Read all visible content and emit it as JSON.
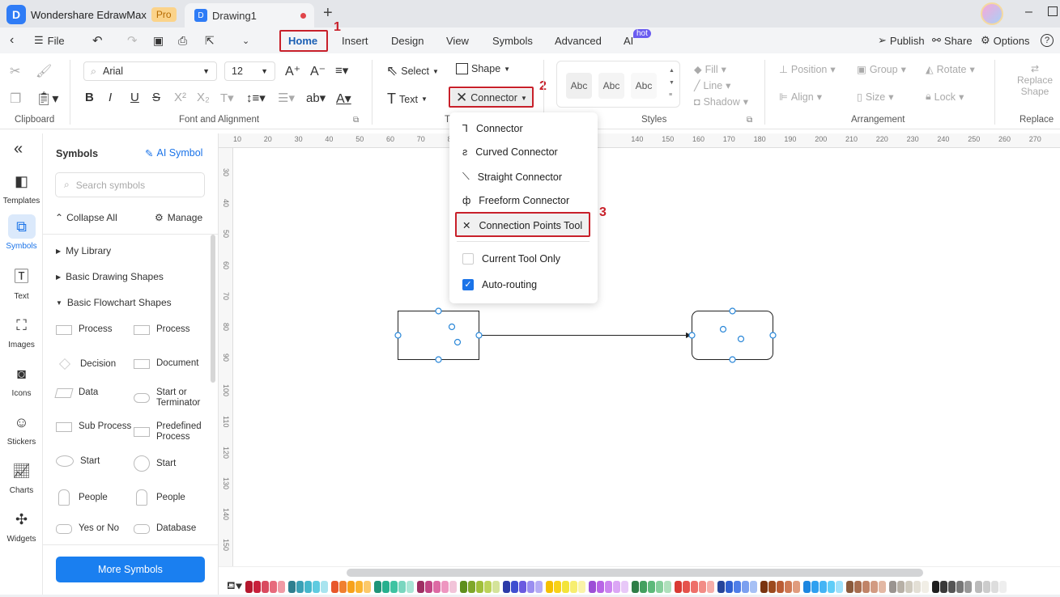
{
  "app": {
    "name": "Wondershare EdrawMax",
    "badge": "Pro",
    "doc_tab": "Drawing1",
    "new_tab": "+"
  },
  "menu": {
    "file": "File",
    "tabs": [
      "Home",
      "Insert",
      "Design",
      "View",
      "Symbols",
      "Advanced",
      "AI"
    ],
    "ai_badge": "hot",
    "publish": "Publish",
    "share": "Share",
    "options": "Options",
    "help": "?"
  },
  "annotations": [
    "1",
    "2",
    "3"
  ],
  "ribbon": {
    "font": "Arial",
    "size": "12",
    "select": "Select",
    "shape": "Shape",
    "text": "Text",
    "connector": "Connector",
    "style_samples": [
      "Abc",
      "Abc",
      "Abc"
    ],
    "fill": "Fill",
    "line": "Line",
    "shadow": "Shadow",
    "position": "Position",
    "group": "Group",
    "rotate": "Rotate",
    "align": "Align",
    "size_btn": "Size",
    "lock": "Lock",
    "replace_shape": "Replace Shape",
    "groups": [
      "Clipboard",
      "Font and Alignment",
      "T",
      "Styles",
      "Arrangement",
      "Replace"
    ]
  },
  "connector_menu": {
    "items": [
      "Connector",
      "Curved Connector",
      "Straight Connector",
      "Freeform Connector",
      "Connection Points Tool"
    ],
    "current_tool_only": "Current Tool Only",
    "current_tool_only_checked": false,
    "auto_routing": "Auto-routing",
    "auto_routing_checked": true
  },
  "leftbar": [
    "Templates",
    "Symbols",
    "Text",
    "Images",
    "Icons",
    "Stickers",
    "Charts",
    "Widgets"
  ],
  "panel": {
    "title": "Symbols",
    "ai_symbol": "AI Symbol",
    "search_placeholder": "Search symbols",
    "collapse_all": "Collapse All",
    "manage": "Manage",
    "categories": [
      "My Library",
      "Basic Drawing Shapes",
      "Basic Flowchart Shapes"
    ],
    "shapes": [
      "Process",
      "Process",
      "Decision",
      "Document",
      "Data",
      "Start or Terminator",
      "Sub Process",
      "Predefined Process",
      "Start",
      "Start",
      "People",
      "People",
      "Yes or No",
      "Database"
    ],
    "more": "More Symbols"
  },
  "ruler": {
    "top": [
      "10",
      "20",
      "30",
      "40",
      "50",
      "60",
      "70",
      "80",
      "",
      "",
      "",
      "",
      "",
      "140",
      "150",
      "160",
      "170",
      "180",
      "190",
      "200",
      "210",
      "220",
      "230",
      "240",
      "250",
      "260",
      "270",
      "28"
    ],
    "left": [
      "30",
      "40",
      "50",
      "60",
      "70",
      "80",
      "90",
      "100",
      "110",
      "120",
      "130",
      "140",
      "150"
    ]
  },
  "palette": [
    "#b5182e",
    "#c8203b",
    "#d94a5f",
    "#e76a7c",
    "#f09aa5",
    "#2e7f8f",
    "#3aa0b5",
    "#45b7cc",
    "#5fcbe0",
    "#a8e4ef",
    "#e8572a",
    "#f08030",
    "#f7a21b",
    "#fbb430",
    "#fcc96a",
    "#1f9478",
    "#27b08e",
    "#3fc3a2",
    "#79d6bf",
    "#a9e6d6",
    "#9e2f63",
    "#c24685",
    "#dd6aa4",
    "#ee96c0",
    "#f2c4d9",
    "#5e8f1c",
    "#7fa72a",
    "#a0bf3a",
    "#bcd35a",
    "#d4e39a",
    "#2b3aa8",
    "#3f4fd0",
    "#6a5ae0",
    "#9a8ef0",
    "#b5acf5",
    "#f5c000",
    "#f8d21a",
    "#f3e43a",
    "#f7ee70",
    "#faf4a8",
    "#9c4fd6",
    "#b865e6",
    "#cc85f0",
    "#dba6f5",
    "#e8c8f8",
    "#2e7d46",
    "#43a05f",
    "#5db97a",
    "#86cf9c",
    "#afe0bc",
    "#d93a33",
    "#e5534c",
    "#ee6f69",
    "#f28c86",
    "#f6aea9",
    "#25449a",
    "#2f5fd0",
    "#4f7ee8",
    "#7ba0f0",
    "#a6c0f5",
    "#7a3410",
    "#9c4a1e",
    "#ba5c34",
    "#cf7a55",
    "#e09c7e",
    "#1c86e0",
    "#2fa0f0",
    "#44b4f5",
    "#5fcdf8",
    "#9fe1fb",
    "#8a5a3c",
    "#a86e50",
    "#c08468",
    "#d29b82",
    "#e3b8a4",
    "#9a9490",
    "#b7b0a6",
    "#cfcabe",
    "#e3dfd5",
    "#f1eee6",
    "#1e1e1e",
    "#3a3a3a",
    "#555555",
    "#777777",
    "#999999",
    "#bbbbbb",
    "#cccccc",
    "#dddddd",
    "#eeeeee"
  ],
  "colors": {
    "accent": "#1a73e8",
    "annotation_red": "#c8202a"
  }
}
